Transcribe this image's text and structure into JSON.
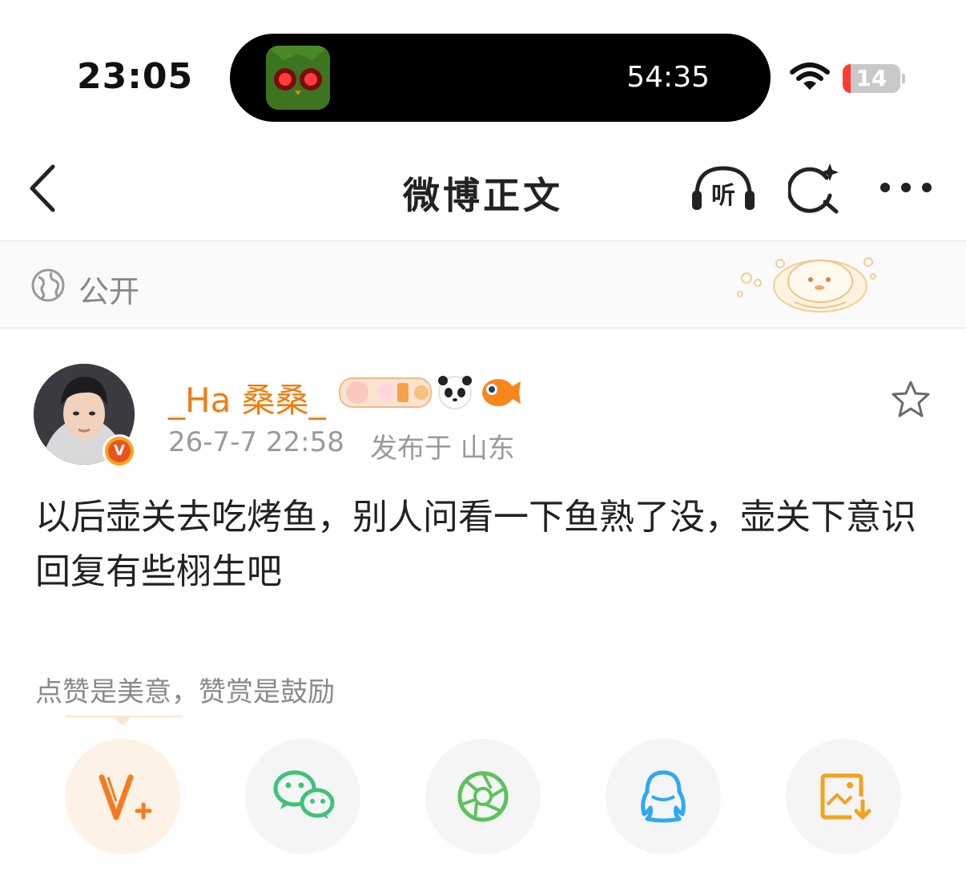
{
  "status_bar": {
    "time": "23:05",
    "island_timer": "54:35",
    "battery_level": "14"
  },
  "nav": {
    "title": "微博正文",
    "listen_label": "听"
  },
  "visibility": {
    "label": "公开"
  },
  "post": {
    "author": {
      "name": "_Ha 桑桑_",
      "verified_badge": "V"
    },
    "time": "26-7-7 22:58",
    "location": "发布于 山东",
    "text": "以后壶关去吃烤鱼，别人问看一下鱼熟了没，壶关下意识回复有些栩生吧"
  },
  "reward": {
    "tip": "点赞是美意，赞赏是鼓励"
  },
  "share_buttons": [
    {
      "name": "vplus",
      "icon": "v-plus-icon"
    },
    {
      "name": "wechat",
      "icon": "wechat-icon"
    },
    {
      "name": "moments",
      "icon": "moments-icon"
    },
    {
      "name": "qq",
      "icon": "qq-icon"
    },
    {
      "name": "save-image",
      "icon": "save-image-icon"
    }
  ],
  "colors": {
    "accent": "#f07d10",
    "wechat": "#3fc27a",
    "moments": "#5cc25c",
    "qq": "#2fa8f0",
    "save": "#f3a21c",
    "battery_low": "#ff3b30"
  }
}
